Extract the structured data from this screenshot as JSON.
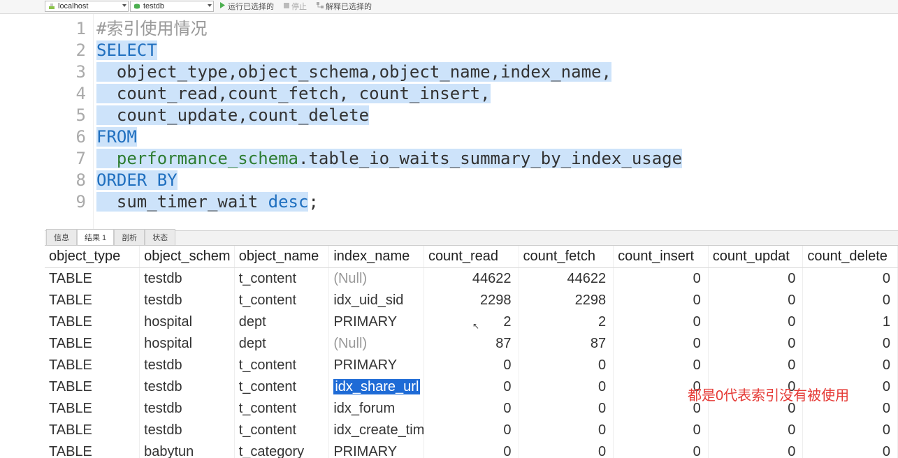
{
  "toolbar": {
    "connection": "localhost",
    "database": "testdb",
    "run_label": "运行已选择的",
    "stop_label": "停止",
    "explain_label": "解释已选择的"
  },
  "editor": {
    "lines": [
      {
        "n": "1",
        "seg": [
          {
            "t": "#索引使用情况",
            "c": "cm",
            "sel": false
          }
        ]
      },
      {
        "n": "2",
        "seg": [
          {
            "t": "SELECT",
            "c": "kw",
            "sel": true
          }
        ]
      },
      {
        "n": "3",
        "seg": [
          {
            "t": "  object_type,object_schema,object_name,index_name,",
            "c": "",
            "sel": true
          }
        ]
      },
      {
        "n": "4",
        "seg": [
          {
            "t": "  count_read,count_fetch, count_insert,",
            "c": "",
            "sel": true
          }
        ]
      },
      {
        "n": "5",
        "seg": [
          {
            "t": "  count_update,count_delete",
            "c": "",
            "sel": true
          }
        ]
      },
      {
        "n": "6",
        "seg": [
          {
            "t": "FROM",
            "c": "kw",
            "sel": true
          }
        ]
      },
      {
        "n": "7",
        "seg": [
          {
            "t": "  ",
            "c": "",
            "sel": true
          },
          {
            "t": "performance_schema",
            "c": "id",
            "sel": true
          },
          {
            "t": ".table_io_waits_summary_by_index_usage",
            "c": "",
            "sel": true
          }
        ]
      },
      {
        "n": "8",
        "seg": [
          {
            "t": "ORDER BY",
            "c": "kw",
            "sel": true
          }
        ]
      },
      {
        "n": "9",
        "seg": [
          {
            "t": "  sum_timer_wait ",
            "c": "",
            "sel": true
          },
          {
            "t": "desc",
            "c": "kw",
            "sel": true
          },
          {
            "t": ";",
            "c": "",
            "sel": false
          }
        ]
      }
    ]
  },
  "tabs": {
    "items": [
      {
        "label": "信息",
        "active": false
      },
      {
        "label": "结果 1",
        "active": true
      },
      {
        "label": "剖析",
        "active": false
      },
      {
        "label": "状态",
        "active": false
      }
    ]
  },
  "results": {
    "columns": [
      "object_type",
      "object_schem",
      "object_name",
      "index_name",
      "count_read",
      "count_fetch",
      "count_insert",
      "count_updat",
      "count_delete"
    ],
    "rows": [
      {
        "object_type": "TABLE",
        "object_schema": "testdb",
        "object_name": "t_content",
        "index_name": "(Null)",
        "index_null": true,
        "count_read": 44622,
        "count_fetch": 44622,
        "count_insert": 0,
        "count_update": 0,
        "count_delete": 0
      },
      {
        "object_type": "TABLE",
        "object_schema": "testdb",
        "object_name": "t_content",
        "index_name": "idx_uid_sid",
        "index_null": false,
        "count_read": 2298,
        "count_fetch": 2298,
        "count_insert": 0,
        "count_update": 0,
        "count_delete": 0
      },
      {
        "object_type": "TABLE",
        "object_schema": "hospital",
        "object_name": "dept",
        "index_name": "PRIMARY",
        "index_null": false,
        "count_read": 2,
        "count_fetch": 2,
        "count_insert": 0,
        "count_update": 0,
        "count_delete": 1
      },
      {
        "object_type": "TABLE",
        "object_schema": "hospital",
        "object_name": "dept",
        "index_name": "(Null)",
        "index_null": true,
        "count_read": 87,
        "count_fetch": 87,
        "count_insert": 0,
        "count_update": 0,
        "count_delete": 0
      },
      {
        "object_type": "TABLE",
        "object_schema": "testdb",
        "object_name": "t_content",
        "index_name": "PRIMARY",
        "index_null": false,
        "count_read": 0,
        "count_fetch": 0,
        "count_insert": 0,
        "count_update": 0,
        "count_delete": 0
      },
      {
        "object_type": "TABLE",
        "object_schema": "testdb",
        "object_name": "t_content",
        "index_name": "idx_share_url",
        "index_null": false,
        "selected": true,
        "count_read": 0,
        "count_fetch": 0,
        "count_insert": 0,
        "count_update": 0,
        "count_delete": 0
      },
      {
        "object_type": "TABLE",
        "object_schema": "testdb",
        "object_name": "t_content",
        "index_name": "idx_forum",
        "index_null": false,
        "count_read": 0,
        "count_fetch": 0,
        "count_insert": 0,
        "count_update": 0,
        "count_delete": 0
      },
      {
        "object_type": "TABLE",
        "object_schema": "testdb",
        "object_name": "t_content",
        "index_name": "idx_create_tim",
        "index_null": false,
        "count_read": 0,
        "count_fetch": 0,
        "count_insert": 0,
        "count_update": 0,
        "count_delete": 0
      },
      {
        "object_type": "TABLE",
        "object_schema": "babytun",
        "object_name": "t_category",
        "index_name": "PRIMARY",
        "index_null": false,
        "count_read": 0,
        "count_fetch": 0,
        "count_insert": 0,
        "count_update": 0,
        "count_delete": 0
      }
    ],
    "current_row_index": 5
  },
  "annotation_text": "都是0代表索引没有被使用"
}
